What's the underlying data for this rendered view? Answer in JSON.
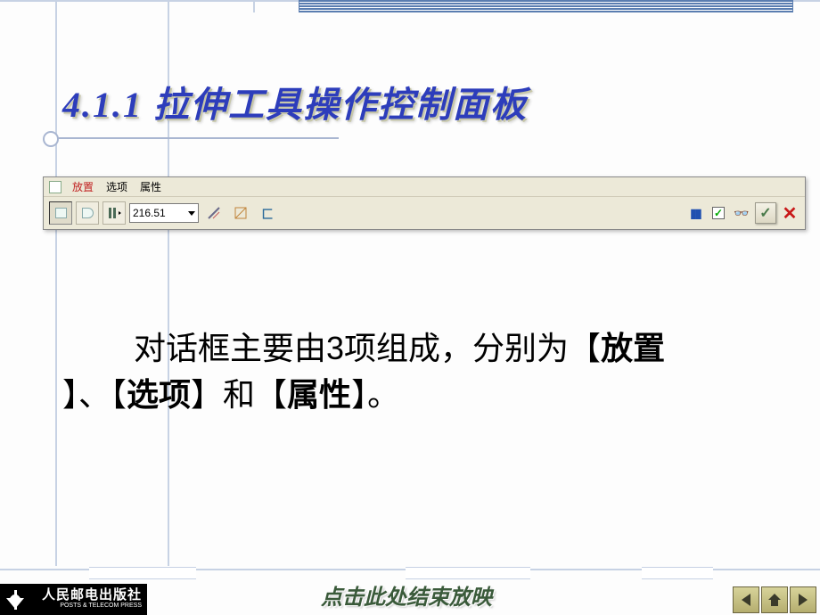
{
  "heading": "4.1.1 拉伸工具操作控制面板",
  "panel": {
    "tabs": {
      "place": "放置",
      "options": "选项",
      "properties": "属性"
    },
    "value": "216.51"
  },
  "body": {
    "line1_prefix": "对话框主要由",
    "count": "3",
    "line1_suffix": "项组成，分别为【",
    "kw_place": "放置",
    "line2_prefix": "】、【",
    "kw_options": "选项",
    "line2_mid": "】和【",
    "kw_properties": "属性",
    "line2_suffix": "】。"
  },
  "footer_link": "点击此处结束放映",
  "publisher": {
    "cn": "人民邮电出版社",
    "en": "POSTS & TELECOM PRESS"
  },
  "icons": {
    "prev": "prev-arrow-icon",
    "home": "home-icon",
    "next": "next-arrow-icon"
  }
}
